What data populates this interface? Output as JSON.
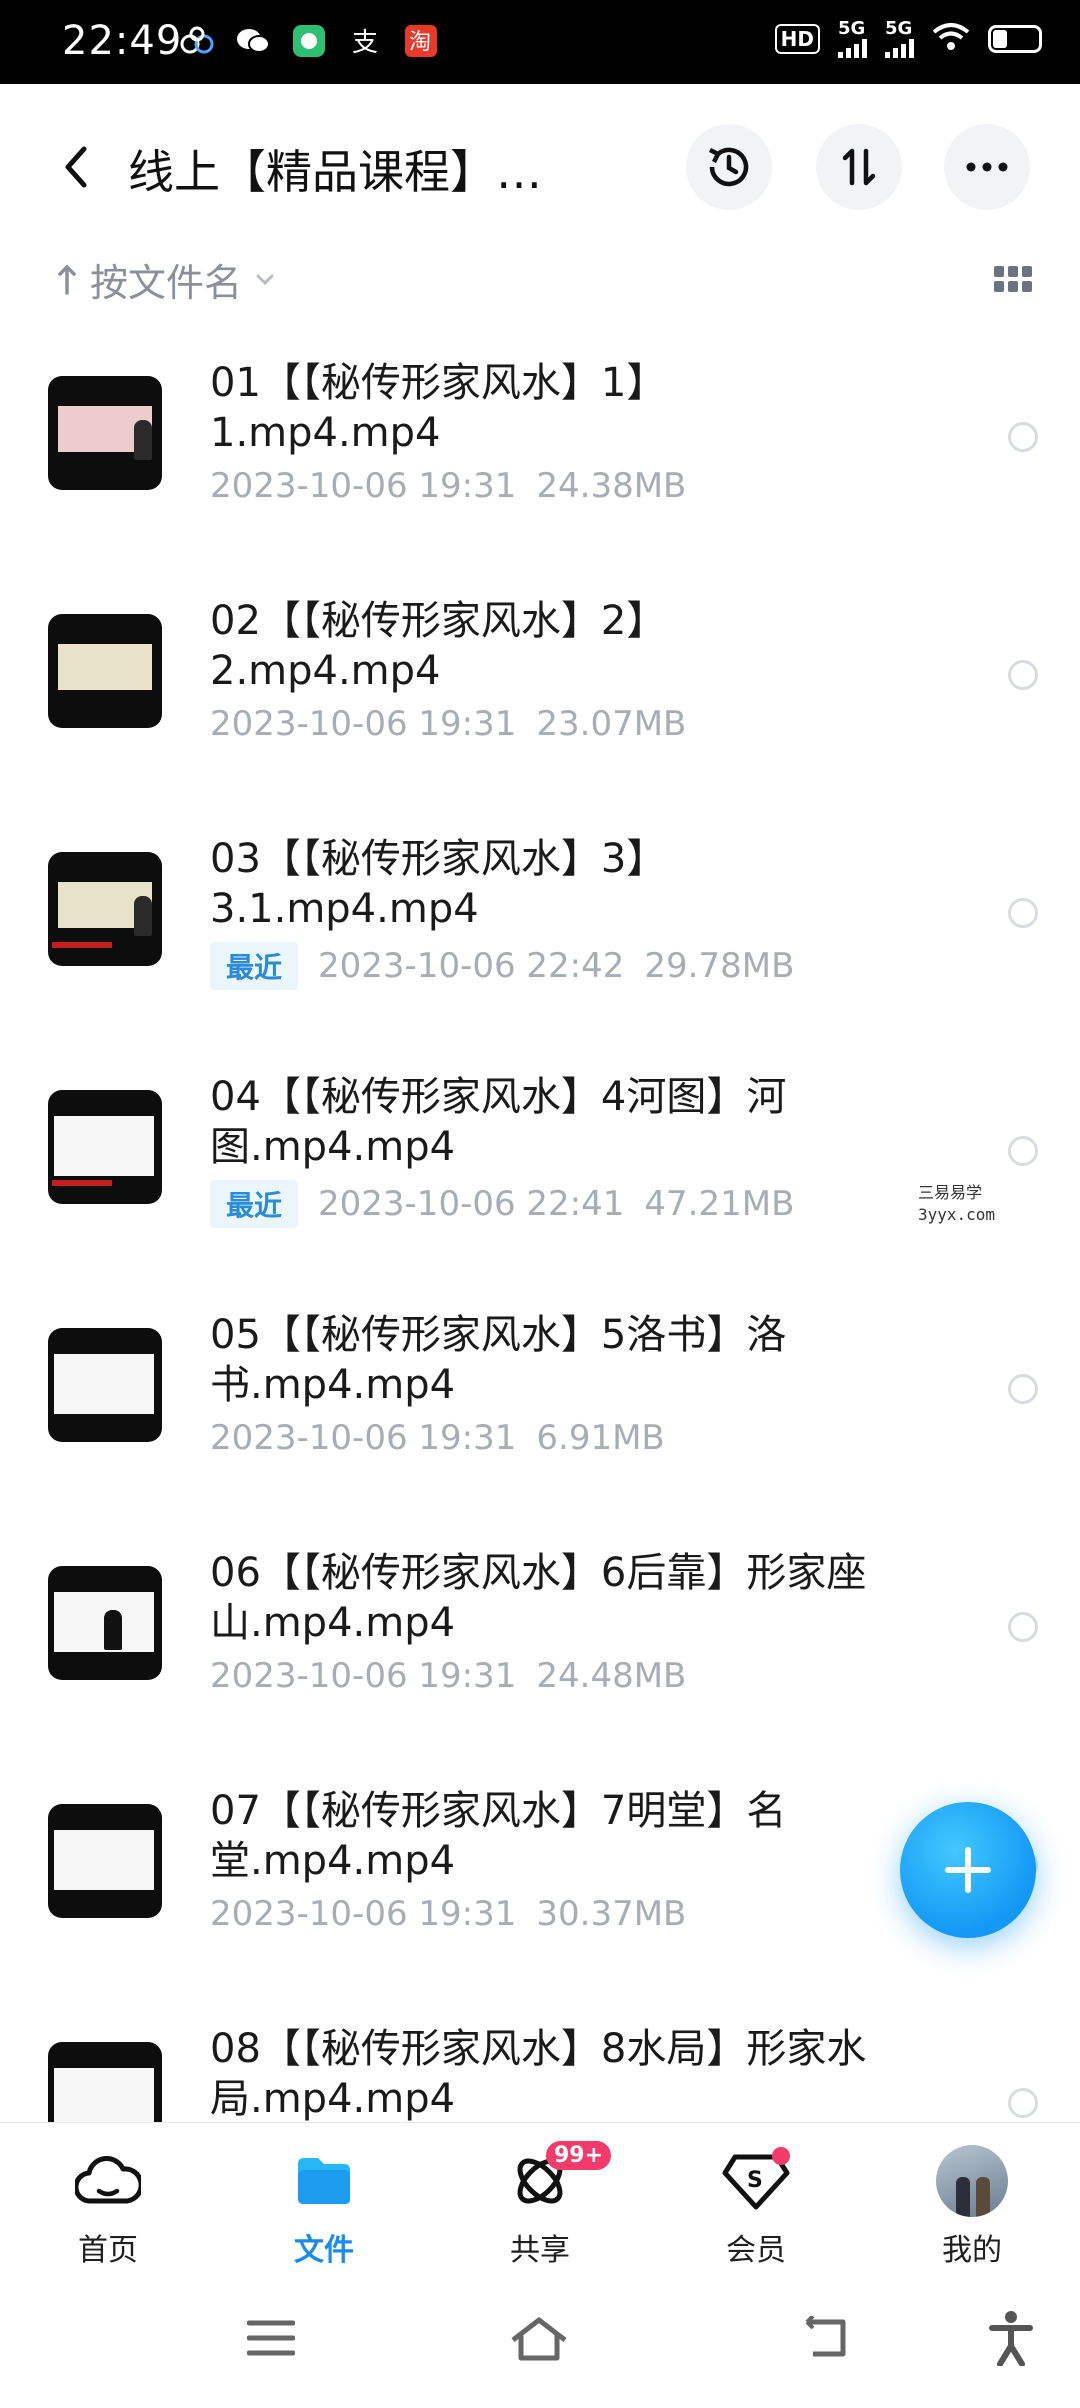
{
  "status_bar": {
    "time": "22:49",
    "apps": [
      "baidu-netdisk-icon",
      "wechat-icon",
      "green-app-icon",
      "alipay-icon",
      "taobao-icon"
    ],
    "hd_label": "HD",
    "sim1": "5G",
    "sim2": "5G",
    "battery_level": 0.25
  },
  "header": {
    "title": "线上【精品课程】…",
    "buttons": [
      "history-icon",
      "transfer-icon",
      "more-icon"
    ]
  },
  "sort": {
    "label": "按文件名"
  },
  "files": [
    {
      "name": "01【【秘传形家风水】1】1.mp4.mp4",
      "recent": "",
      "date": "2023-10-06  19:31",
      "size": "24.38MB"
    },
    {
      "name": "02【【秘传形家风水】2】2.mp4.mp4",
      "recent": "",
      "date": "2023-10-06  19:31",
      "size": "23.07MB"
    },
    {
      "name": "03【【秘传形家风水】3】3.1.mp4.mp4",
      "recent": "最近",
      "date": "2023-10-06  22:42",
      "size": "29.78MB"
    },
    {
      "name": "04【【秘传形家风水】4河图】河图.mp4.mp4",
      "recent": "最近",
      "date": "2023-10-06  22:41",
      "size": "47.21MB"
    },
    {
      "name": "05【【秘传形家风水】5洛书】洛书.mp4.mp4",
      "recent": "",
      "date": "2023-10-06  19:31",
      "size": "6.91MB"
    },
    {
      "name": "06【【秘传形家风水】6后靠】形家座山.mp4.mp4",
      "recent": "",
      "date": "2023-10-06  19:31",
      "size": "24.48MB"
    },
    {
      "name": "07【【秘传形家风水】7明堂】名堂.mp4.mp4",
      "recent": "",
      "date": "2023-10-06  19:31",
      "size": "30.37MB"
    },
    {
      "name": "08【【秘传形家风水】8水局】形家水局.mp4.mp4",
      "recent": "",
      "date": "",
      "size": ""
    }
  ],
  "watermark": {
    "line1": "三易易学",
    "line2": "3yyx.com"
  },
  "bottom_nav": {
    "items": [
      {
        "label": "首页",
        "icon": "cloud-home-icon"
      },
      {
        "label": "文件",
        "icon": "folder-icon"
      },
      {
        "label": "共享",
        "icon": "share-icon"
      },
      {
        "label": "会员",
        "icon": "vip-diamond-icon"
      },
      {
        "label": "我的",
        "icon": "avatar"
      }
    ],
    "share_badge": "99+"
  },
  "colors": {
    "accent": "#1a8cf0",
    "badge": "#f23a6b",
    "muted_text": "#a7acb5"
  }
}
